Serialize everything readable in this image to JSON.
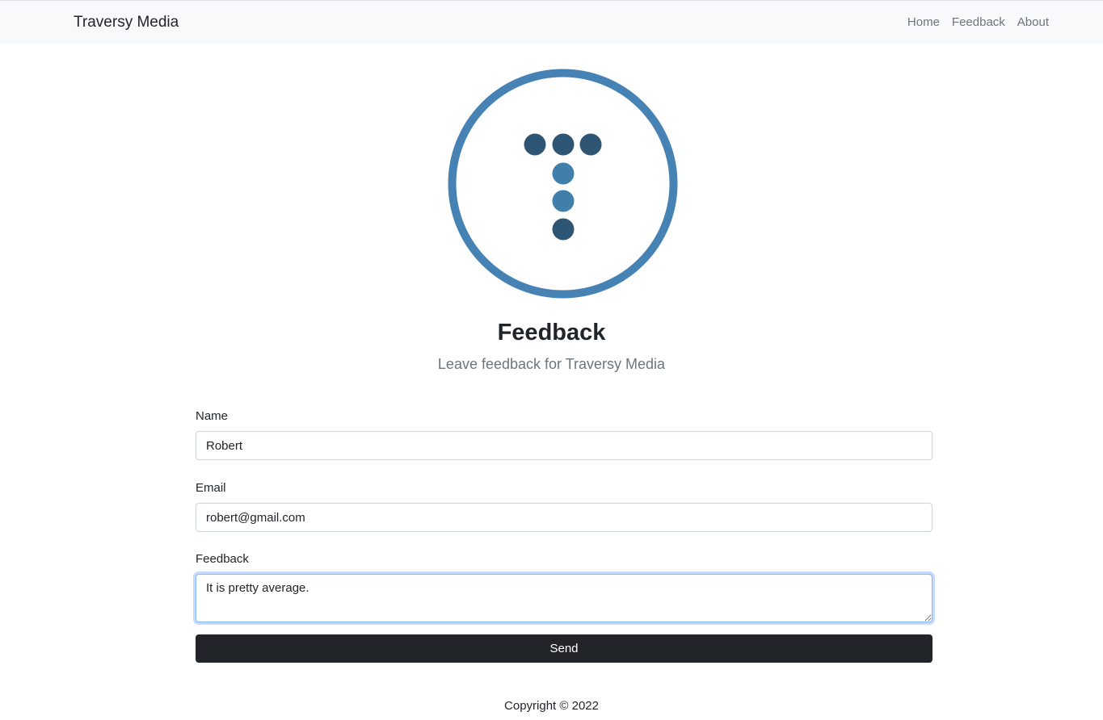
{
  "navbar": {
    "brand": "Traversy Media",
    "links": [
      {
        "label": "Home"
      },
      {
        "label": "Feedback"
      },
      {
        "label": "About"
      }
    ]
  },
  "logo": {
    "icon": "traversy-logo-icon",
    "ring_color": "#4682b4",
    "dark_dot_color": "#2e5573",
    "light_dot_color": "#3f7faa"
  },
  "header": {
    "title": "Feedback",
    "subtitle": "Leave feedback for Traversy Media"
  },
  "form": {
    "name_label": "Name",
    "name_value": "Robert",
    "email_label": "Email",
    "email_value": "robert@gmail.com",
    "feedback_label": "Feedback",
    "feedback_value": "It is pretty average.",
    "send_label": "Send"
  },
  "footer": {
    "copyright": "Copyright © 2022"
  }
}
